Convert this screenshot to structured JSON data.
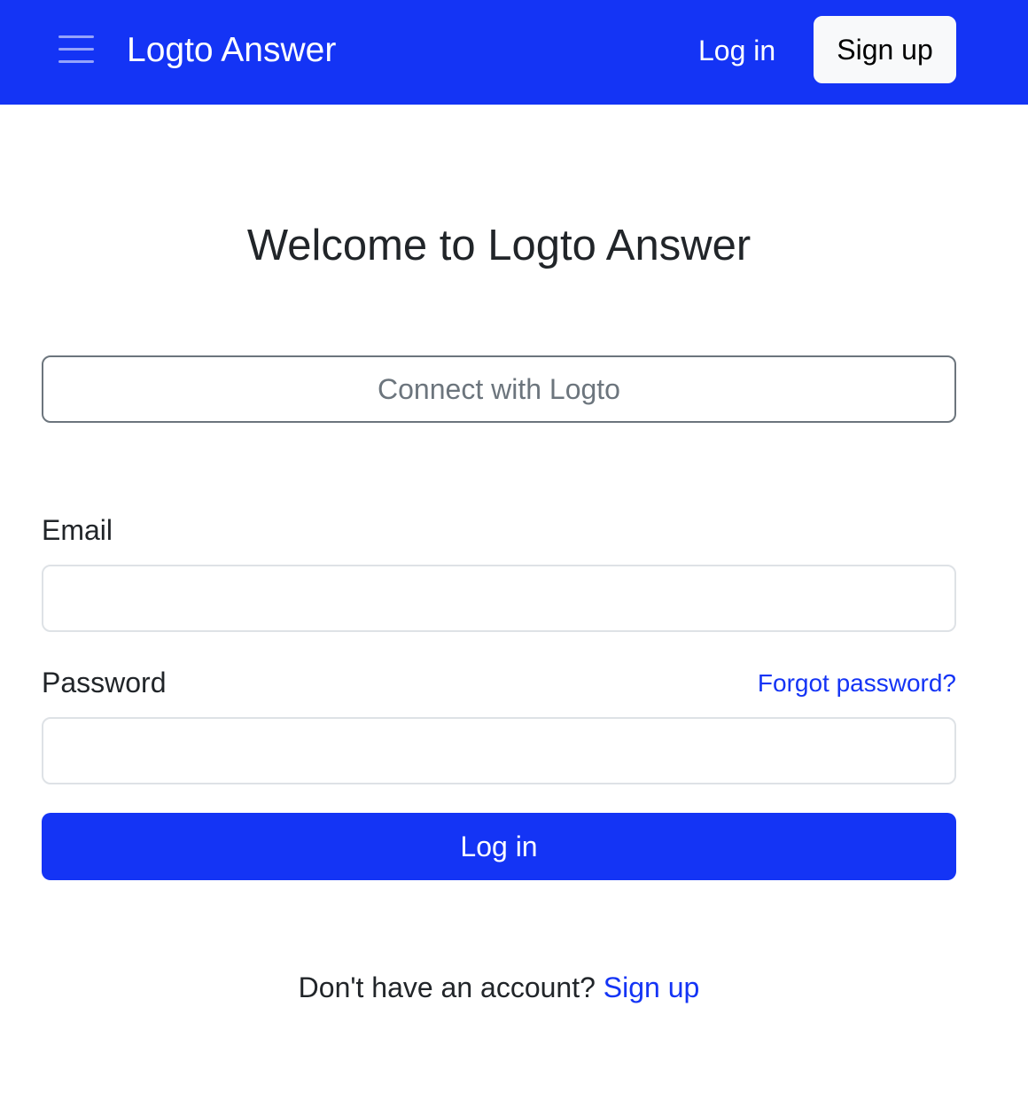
{
  "header": {
    "menu_icon": "hamburger-menu-icon",
    "brand": "Logto Answer",
    "login_label": "Log in",
    "signup_label": "Sign up",
    "background_color": "#1434f5"
  },
  "main": {
    "title": "Welcome to Logto Answer",
    "connect_button_label": "Connect with Logto",
    "email": {
      "label": "Email",
      "value": "",
      "placeholder": ""
    },
    "password": {
      "label": "Password",
      "value": "",
      "placeholder": "",
      "forgot_label": "Forgot password?"
    },
    "login_button_label": "Log in",
    "signup_prompt": {
      "text": "Don't have an account?",
      "link_label": "Sign up"
    }
  },
  "colors": {
    "primary": "#1434f5",
    "text": "#212529",
    "secondary_text": "#6c757d",
    "input_border": "#dee2e6"
  }
}
